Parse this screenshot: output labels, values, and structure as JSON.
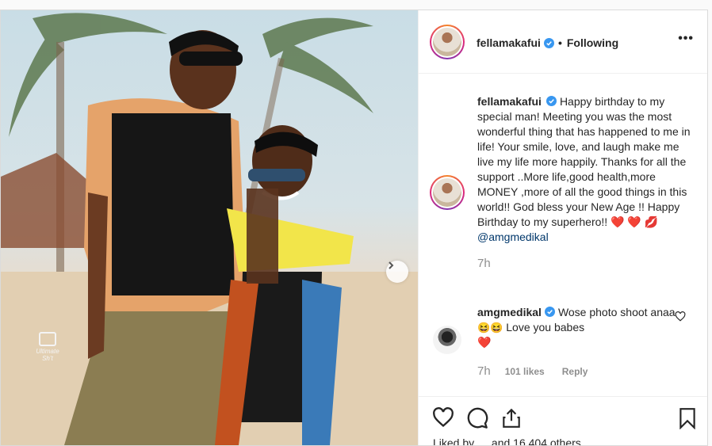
{
  "post": {
    "username": "fellamakafui",
    "following_label": "Following",
    "more_label": "•••",
    "watermark": "Ultimate Sh’t"
  },
  "caption": {
    "username": "fellamakafui",
    "text": "Happy birthday to my special man! Meeting you was the most wonderful thing that has happened to me in life! Your smile, love, and laugh make me live my life more happily. Thanks for all the support ..More life,good health,more MONEY ,more of all the good things in this world!! God bless your New Age !! Happy Birthday to my superhero!! ",
    "mention": "@amgmedikal",
    "time": "7h"
  },
  "comment": {
    "username": "amgmedikal",
    "text": "Wose photo shoot anaa ",
    "text2": " Love you babes",
    "time": "7h",
    "likes": "101 likes",
    "reply": "Reply"
  },
  "liked_by": "Liked by … and 16,404 others",
  "icons": {
    "like": "heart-icon",
    "comment": "comment-icon",
    "share": "share-icon",
    "save": "bookmark-icon",
    "verified": "verified-badge-icon",
    "next": "chevron-right-icon"
  },
  "colors": {
    "verified": "#3897f0",
    "heart": "#ed4956",
    "muted": "#8e8e8e"
  }
}
